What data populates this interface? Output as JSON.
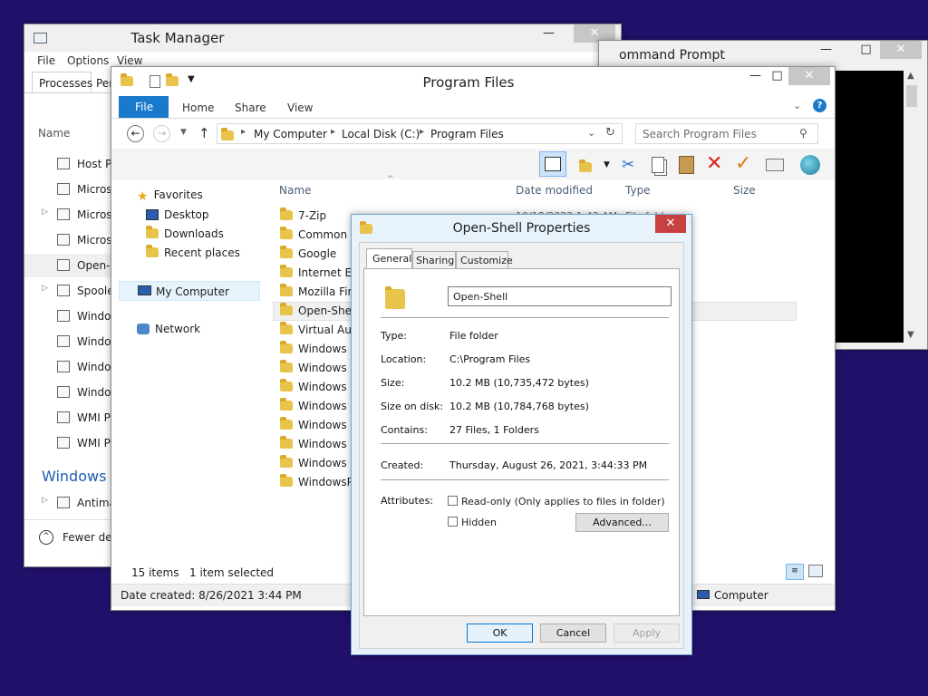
{
  "task_manager": {
    "title": "Task Manager",
    "menu": [
      "File",
      "Options",
      "View"
    ],
    "tabs": [
      "Processes",
      "Per"
    ],
    "column_name": "Name",
    "rows": [
      {
        "label": "Host Pr",
        "expandable": false
      },
      {
        "label": "Micros",
        "expandable": false
      },
      {
        "label": "Micros",
        "expandable": true
      },
      {
        "label": "Micros",
        "expandable": false
      },
      {
        "label": "Open-S",
        "expandable": false
      },
      {
        "label": "Spoole",
        "expandable": true
      },
      {
        "label": "Window",
        "expandable": false
      },
      {
        "label": "Window",
        "expandable": false
      },
      {
        "label": "Window",
        "expandable": false
      },
      {
        "label": "Window",
        "expandable": false
      },
      {
        "label": "WMI Pr",
        "expandable": false
      },
      {
        "label": "WMI Pr",
        "expandable": false
      }
    ],
    "section_heading": "Windows p",
    "last_row": "Antima",
    "fewer_details": "Fewer deta"
  },
  "command_prompt": {
    "title": "ommand Prompt"
  },
  "explorer": {
    "title": "Program Files",
    "ribbon_tabs": [
      "File",
      "Home",
      "Share",
      "View"
    ],
    "breadcrumb": [
      "My Computer",
      "Local Disk (C:)",
      "Program Files"
    ],
    "search_placeholder": "Search Program Files",
    "columns": {
      "name": "Name",
      "date": "Date modified",
      "type": "Type",
      "size": "Size"
    },
    "partial_date": "10/18/2022 1:43 AM",
    "partial_type": "File fold",
    "nav": {
      "favorites": "Favorites",
      "desktop": "Desktop",
      "downloads": "Downloads",
      "recent": "Recent places",
      "my_computer": "My Computer",
      "network": "Network"
    },
    "files": [
      "7-Zip",
      "Common F",
      "Google",
      "Internet Exp",
      "Mozilla Fire",
      "Open-Shell",
      "Virtual Aud",
      "Windows D",
      "Windows M",
      "Windows M",
      "Windows M",
      "Windows N",
      "Windows P",
      "Windows P",
      "WindowsPo"
    ],
    "status_items": "15 items",
    "status_selected": "1 item selected",
    "details_bar": "Date created: 8/26/2021 3:44 PM",
    "details_location": "Computer"
  },
  "dialog": {
    "title": "Open-Shell Properties",
    "tabs": [
      "General",
      "Sharing",
      "Customize"
    ],
    "name_value": "Open-Shell",
    "fields": {
      "type_label": "Type:",
      "type_value": "File folder",
      "location_label": "Location:",
      "location_value": "C:\\Program Files",
      "size_label": "Size:",
      "size_value": "10.2 MB (10,735,472 bytes)",
      "size_disk_label": "Size on disk:",
      "size_disk_value": "10.2 MB (10,784,768 bytes)",
      "contains_label": "Contains:",
      "contains_value": "27 Files, 1 Folders",
      "created_label": "Created:",
      "created_value": "Thursday, August 26, 2021, 3:44:33 PM",
      "attributes_label": "Attributes:"
    },
    "readonly_label": "Read-only (Only applies to files in folder)",
    "hidden_label": "Hidden",
    "advanced_label": "Advanced...",
    "ok_label": "OK",
    "cancel_label": "Cancel",
    "apply_label": "Apply"
  },
  "colors": {
    "desktop": "#22116b",
    "accent": "#1979ca",
    "close_red": "#c74141"
  }
}
